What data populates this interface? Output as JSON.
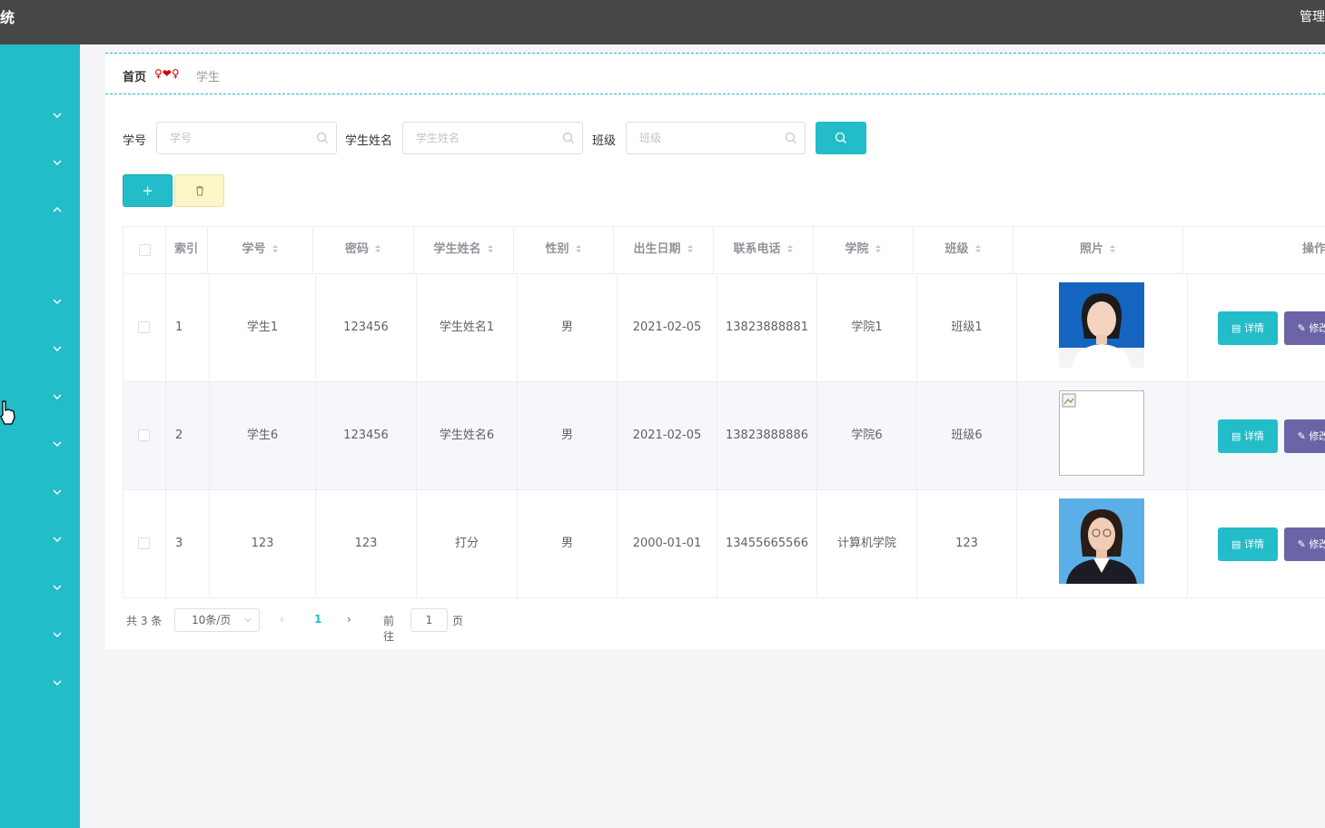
{
  "header": {
    "app_title": "统",
    "admin_label": "管理"
  },
  "breadcrumb": {
    "home": "首页",
    "separator": "♀❤♀",
    "current": "学生"
  },
  "search": {
    "student_no_label": "学号",
    "student_no_placeholder": "学号",
    "student_name_label": "学生姓名",
    "student_name_placeholder": "学生姓名",
    "class_label": "班级",
    "class_placeholder": "班级"
  },
  "actions": {
    "add_label": "+"
  },
  "table": {
    "columns": [
      "索引",
      "学号",
      "密码",
      "学生姓名",
      "性别",
      "出生日期",
      "联系电话",
      "学院",
      "班级",
      "照片",
      "操作"
    ],
    "rows": [
      {
        "index": "1",
        "student_no": "学生1",
        "password": "123456",
        "name": "学生姓名1",
        "gender": "男",
        "birth": "2021-02-05",
        "phone": "13823888881",
        "college": "学院1",
        "class": "班级1"
      },
      {
        "index": "2",
        "student_no": "学生6",
        "password": "123456",
        "name": "学生姓名6",
        "gender": "男",
        "birth": "2021-02-05",
        "phone": "13823888886",
        "college": "学院6",
        "class": "班级6"
      },
      {
        "index": "3",
        "student_no": "123",
        "password": "123",
        "name": "打分",
        "gender": "男",
        "birth": "2000-01-01",
        "phone": "13455665566",
        "college": "计算机学院",
        "class": "123"
      }
    ],
    "detail_label": "详情",
    "edit_label": "修改"
  },
  "pagination": {
    "total": "共 3 条",
    "page_size": "10条/页",
    "current_page": "1",
    "goto_label": "前往",
    "goto_value": "1",
    "page_unit": "页"
  },
  "colors": {
    "accent": "#23bcc9",
    "header_bg": "#474747",
    "edit_button": "#6b65a8",
    "delete_button": "#fbf6c8"
  }
}
